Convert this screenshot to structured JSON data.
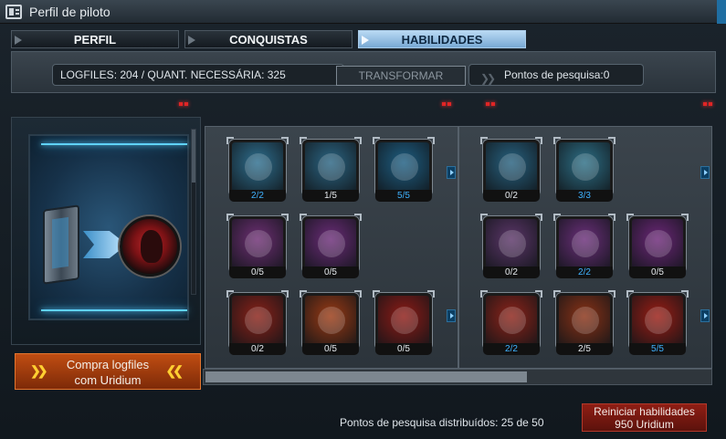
{
  "window": {
    "title": "Perfil de piloto",
    "icon": "profile-card-icon"
  },
  "tabs": [
    {
      "label": "PERFIL",
      "active": false
    },
    {
      "label": "CONQUISTAS",
      "active": false
    },
    {
      "label": "HABILIDADES",
      "active": true
    }
  ],
  "infobar": {
    "logfiles_text": "LOGFILES: 204 / QUANT. NECESSÁRIA: 325",
    "transform_label": "TRANSFORMAR",
    "research_points_text": "Pontos de pesquisa:0"
  },
  "left_panel": {
    "buy_line1": "Compra logfiles",
    "buy_line2": "com Uridium"
  },
  "skill_panels": [
    {
      "skills": [
        {
          "icon": "cargo-hold-icon",
          "level": "2/2",
          "complete": true,
          "color": "#2e6f8f"
        },
        {
          "icon": "wrench-icon",
          "level": "1/5",
          "complete": false,
          "color": "#2b6583"
        },
        {
          "icon": "ship-shield-icon",
          "level": "5/5",
          "complete": true,
          "color": "#1e5e82"
        },
        {
          "icon": "pilot-eyepatch-icon",
          "level": "0/5",
          "complete": false,
          "color": "#6e2f74"
        },
        {
          "icon": "gear-parts-icon",
          "level": "0/5",
          "complete": false,
          "color": "#6b2c78"
        },
        {
          "icon": "skull-icon",
          "level": "0/2",
          "complete": false,
          "color": "#8a2118"
        },
        {
          "icon": "explosion-icon",
          "level": "0/5",
          "complete": false,
          "color": "#9a3a14"
        },
        {
          "icon": "green-arrows-icon",
          "level": "0/5",
          "complete": false,
          "color": "#8e1b16"
        }
      ]
    },
    {
      "skills": [
        {
          "icon": "rocket-icon",
          "level": "0/2",
          "complete": false,
          "color": "#27617f"
        },
        {
          "icon": "cargo-hold-icon",
          "level": "3/3",
          "complete": true,
          "color": "#2d6f86"
        },
        {
          "icon": "cube-icon",
          "level": "0/2",
          "complete": false,
          "color": "#5c3669"
        },
        {
          "icon": "fist-icon",
          "level": "2/2",
          "complete": true,
          "color": "#6b2f7a"
        },
        {
          "icon": "energy-beam-icon",
          "level": "0/5",
          "complete": false,
          "color": "#6c2778"
        },
        {
          "icon": "pilot-face-icon",
          "level": "2/2",
          "complete": true,
          "color": "#8d2319"
        },
        {
          "icon": "rifle-icon",
          "level": "2/5",
          "complete": false,
          "color": "#8a3216"
        },
        {
          "icon": "laser-icon",
          "level": "5/5",
          "complete": true,
          "color": "#9a1d14"
        }
      ]
    }
  ],
  "footer": {
    "distributed_text": "Pontos de pesquisa distribuídos: 25 de 50",
    "reset_line1": "Reiniciar habilidades",
    "reset_line2": "950 Uridium"
  }
}
